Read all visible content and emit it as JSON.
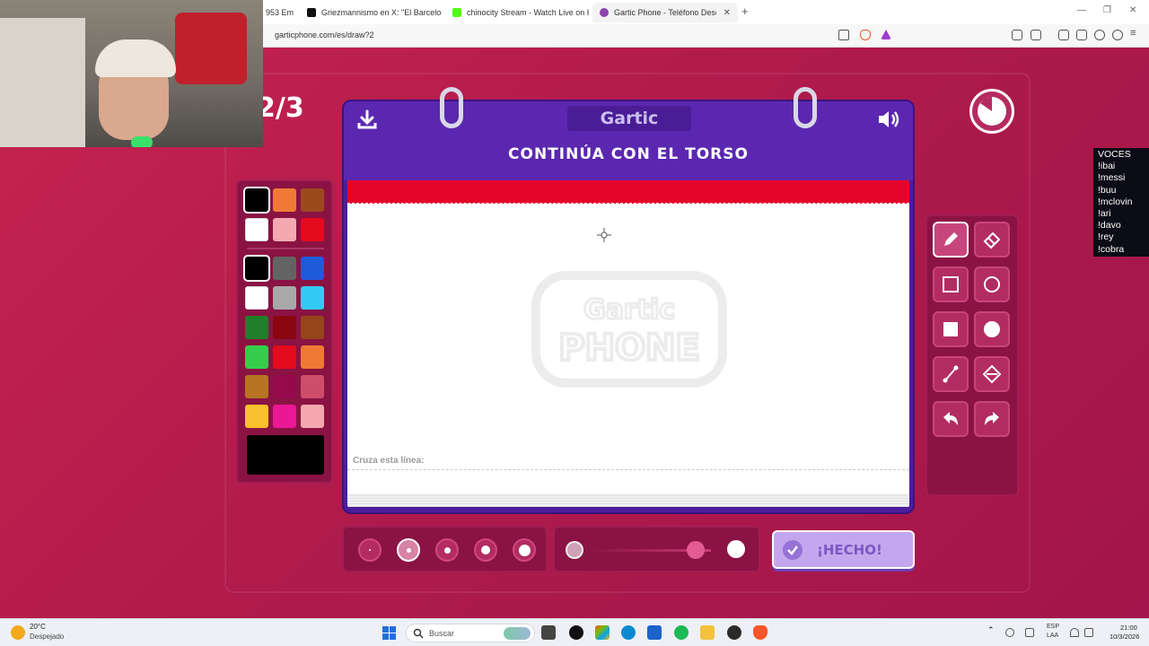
{
  "browser": {
    "tabs": [
      {
        "title": "953 Em",
        "favicon_color": "#c0392b"
      },
      {
        "title": "Griezmannismo en X: \"El Barcelona n",
        "favicon_color": "#111111"
      },
      {
        "title": "chinocity Stream - Watch Live on Kick",
        "favicon_color": "#53fc18"
      },
      {
        "title": "Gartic Phone - Teléfono Descon",
        "favicon_color": "#8e44ad"
      }
    ],
    "new_tab": "+",
    "close_tab": "✕",
    "url": "garticphone.com/es/draw?2",
    "window_controls": [
      "—",
      "❐",
      "✕"
    ]
  },
  "game": {
    "round_label": "2/3",
    "logo": "Gartic",
    "instruction": "CONTINÚA CON EL TORSO",
    "cross_line_label": "Cruza esta línea:",
    "watermark_line1": "Gartic",
    "watermark_line2": "PHONE",
    "done_label": "¡HECHO!",
    "palette_top": [
      "#000000",
      "#f07a35",
      "#9b4a1e",
      "#ffffff",
      "#f4a9b0",
      "#e30b1c"
    ],
    "palette_main": [
      "#000000",
      "#636363",
      "#1e5bd8",
      "#ffffff",
      "#a8a8a8",
      "#33c9f5",
      "#1f7f2a",
      "#8a0710",
      "#96461a",
      "#35cd4b",
      "#e30b1c",
      "#f07a35",
      "#b77522",
      "#940a4b",
      "#cd4d6a",
      "#fbc02d",
      "#ec1795",
      "#f5a8b0"
    ],
    "current_color": "#000000",
    "tools": [
      "pencil-icon",
      "eraser-icon",
      "square-outline-icon",
      "circle-outline-icon",
      "square-filled-icon",
      "circle-filled-icon",
      "line-icon",
      "fill-bucket-icon",
      "undo-icon",
      "redo-icon"
    ],
    "selected_tool": "pencil-icon",
    "brush_sizes_count": 5,
    "selected_size_index": 1,
    "opacity_value": 0.87,
    "accent_color": "#5b27b0",
    "background_color": "#b01b4c"
  },
  "voices": {
    "title": "VOCES",
    "items": [
      "!ibai",
      "!messi",
      "!buu",
      "!mclovin",
      "!ari",
      "!davo",
      "!rey",
      "!cobra"
    ]
  },
  "taskbar": {
    "weather_temp": "20°C",
    "weather_desc": "Despejado",
    "search_placeholder": "Buscar",
    "lang1": "ESP",
    "lang2": "LAA",
    "time": "21:00",
    "date": "10/3/2026"
  }
}
